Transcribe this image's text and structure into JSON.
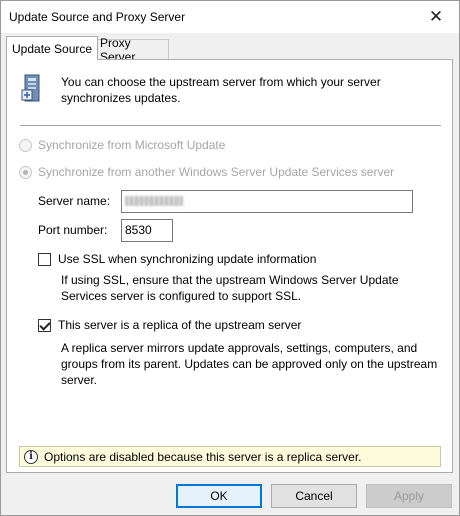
{
  "window": {
    "title": "Update Source and Proxy Server",
    "close_glyph": "✕"
  },
  "tabs": [
    {
      "label": "Update Source",
      "active": true
    },
    {
      "label": "Proxy Server",
      "active": false
    }
  ],
  "intro": {
    "icon": "server-icon",
    "text": "You can choose the upstream server from which your server synchronizes updates."
  },
  "sync_options": [
    {
      "label": "Synchronize from Microsoft Update",
      "selected": false,
      "enabled": false
    },
    {
      "label": "Synchronize from another Windows Server Update Services server",
      "selected": true,
      "enabled": false
    }
  ],
  "server_name": {
    "label": "Server name:",
    "value": ""
  },
  "port_number": {
    "label": "Port number:",
    "value": "8530"
  },
  "use_ssl": {
    "label": "Use SSL when synchronizing update information",
    "checked": false,
    "description": "If using SSL, ensure that the upstream Windows Server Update Services server is configured to support SSL."
  },
  "replica": {
    "label": "This server is a replica of the upstream server",
    "checked": true,
    "description": "A replica server mirrors update approvals, settings, computers, and groups from its parent. Updates can be approved only on the upstream server."
  },
  "banner": {
    "icon": "info-icon",
    "text": "Options are disabled because this server is a replica server."
  },
  "buttons": {
    "ok": "OK",
    "cancel": "Cancel",
    "apply": "Apply"
  },
  "colors": {
    "accent": "#0078d7",
    "banner_bg": "#fcfcdc",
    "disabled_text": "#a6a6a6"
  }
}
